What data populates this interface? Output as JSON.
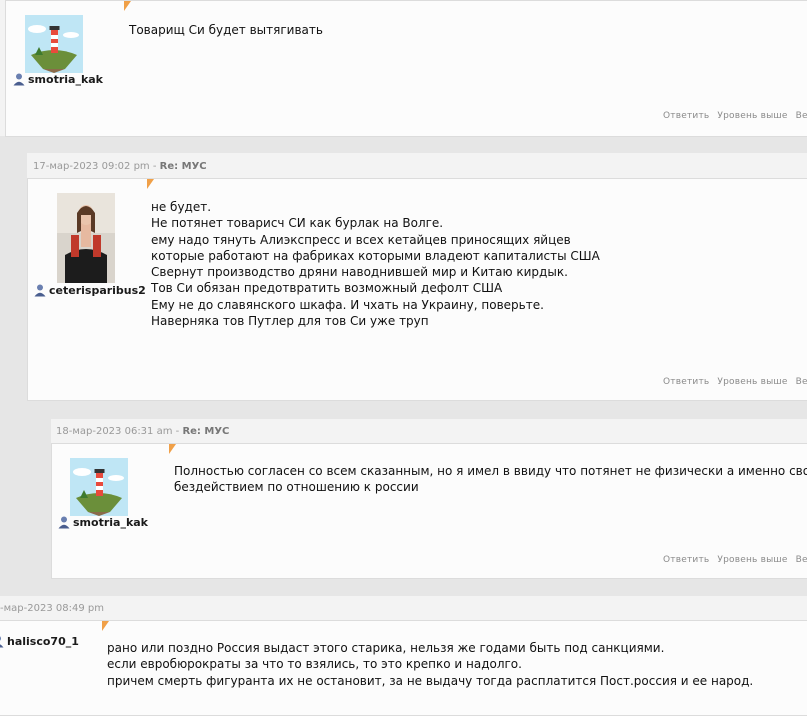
{
  "posts": [
    {
      "username": "smotria_kak",
      "lines": [
        "Товарищ Си будет вытягивать"
      ],
      "actions": [
        "Ответить",
        "Уровень выше",
        "Ветвь д"
      ]
    },
    {
      "meta_date": "17-мар-2023 09:02 pm",
      "meta_sep": " - ",
      "meta_title": "Re: МУС",
      "username": "ceterisparibus2",
      "lines": [
        "не будет.",
        "Не потянет товарисч СИ как бурлак на Волге.",
        "ему надо тянуть Алиэкспресс и всех кетайцев приносящих яйцев",
        "которые работают на фабриках которыми владеют капиталисты США",
        "Свернут производство дряни наводнившей мир и Китаю кирдык.",
        "Тов Си обязан предотвратить возможный дефолт США",
        "Ему не до славянского шкафа. И чхать на Украину, поверьте.",
        "Наверняка тов Путлер для тов Си уже труп"
      ],
      "actions": [
        "Ответить",
        "Уровень выше",
        "Ветвь д"
      ]
    },
    {
      "meta_date": "18-мар-2023 06:31 am",
      "meta_sep": " - ",
      "meta_title": "Re: МУС",
      "username": "smotria_kak",
      "lines": [
        "Полностью согласен со всем сказанным, но я имел в ввиду что потянет не физически а именно своим",
        "бездействием по отношению к россии"
      ],
      "actions": [
        "Ответить",
        "Уровень выше",
        "Ветвь д"
      ]
    },
    {
      "meta_date": "-мар-2023 08:49 pm",
      "username": "halisco70_1",
      "lines": [
        "рано или поздно Россия выдаст этого старика, нельзя же годами быть под санкциями.",
        "если евробюрократы за что то взялись, то это крепко и надолго.",
        "причем смерть фигуранта их не остановит, за не выдачу тогда расплатится Пост.россия и ее народ."
      ]
    }
  ],
  "colors": {
    "notch": "#f0a048",
    "action_text": "#8a8a8a",
    "meta_text": "#999999"
  }
}
